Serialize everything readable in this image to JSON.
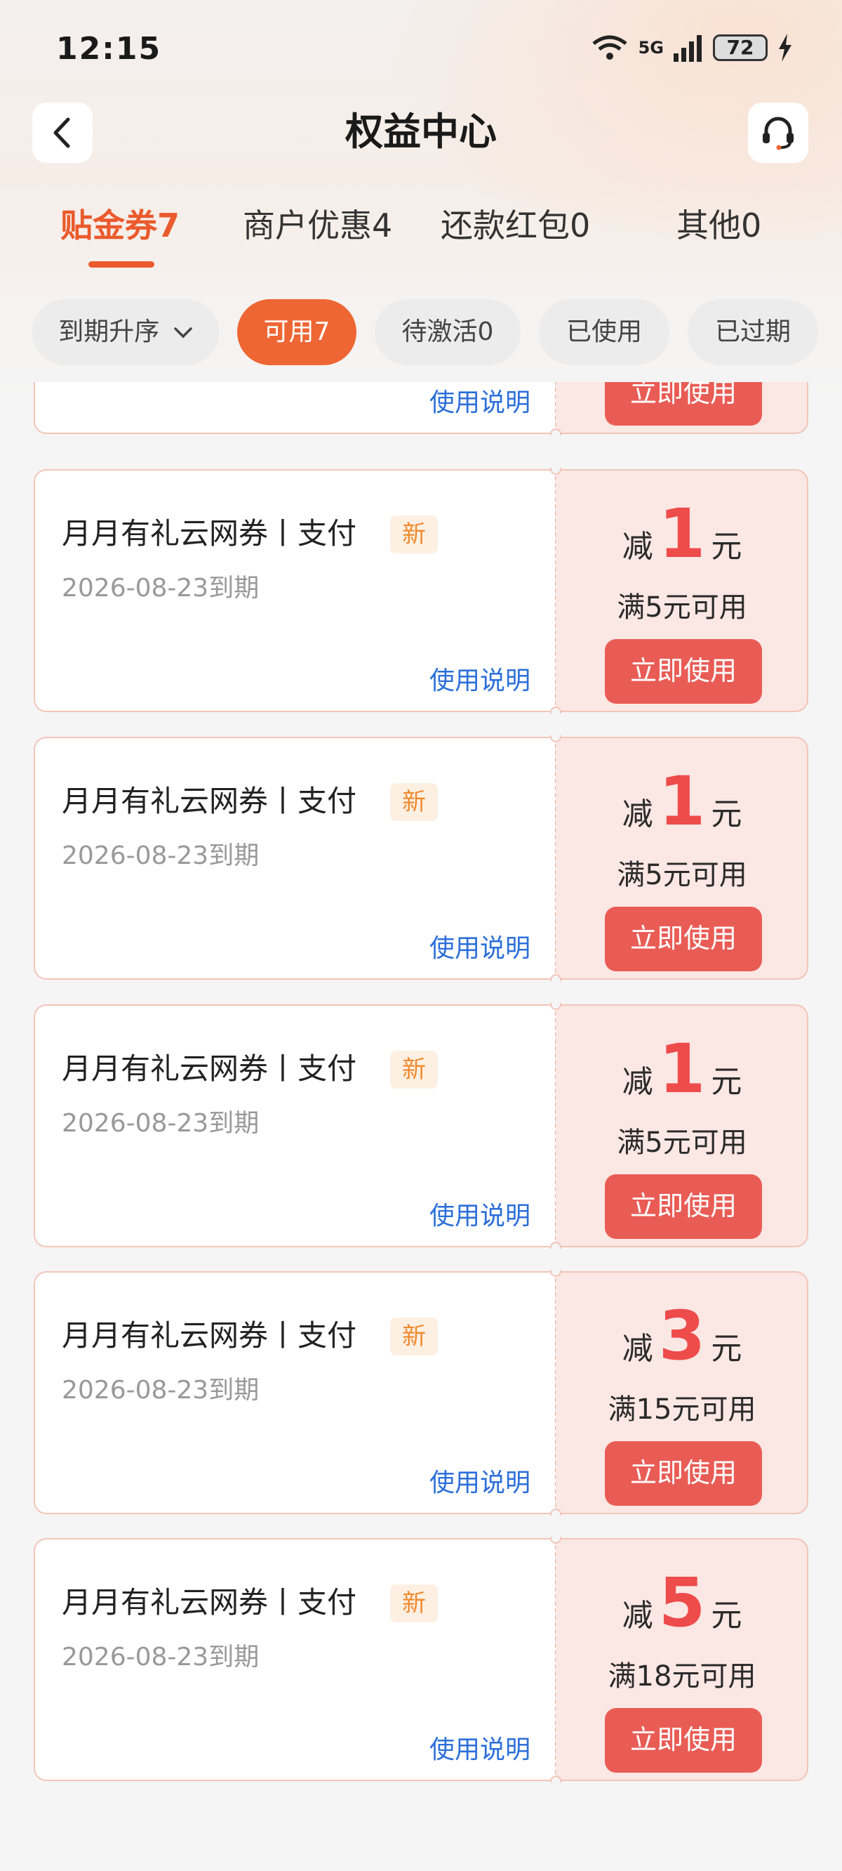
{
  "status_bar": {
    "time": "12:15",
    "battery": "72",
    "network": "5G"
  },
  "header": {
    "title": "权益中心"
  },
  "tabs": [
    {
      "label": "贴金券7",
      "active": true
    },
    {
      "label": "商户优惠4",
      "active": false
    },
    {
      "label": "还款红包0",
      "active": false
    },
    {
      "label": "其他0",
      "active": false
    }
  ],
  "filters": {
    "sort_label": "到期升序",
    "chips": [
      {
        "label": "可用7",
        "active": true
      },
      {
        "label": "待激活0",
        "active": false
      },
      {
        "label": "已使用",
        "active": false
      },
      {
        "label": "已过期",
        "active": false
      }
    ]
  },
  "coupon_labels": {
    "instructions": "使用说明",
    "use_now": "立即使用",
    "badge_new": "新",
    "amount_prefix": "减",
    "amount_unit": "元"
  },
  "coupons": [
    {
      "title": "",
      "date": "",
      "amount": "",
      "min_spend": "",
      "new": false
    },
    {
      "title": "月月有礼云网券丨支付",
      "date": "2026-08-23到期",
      "amount": "1",
      "min_spend": "满5元可用",
      "new": true
    },
    {
      "title": "月月有礼云网券丨支付",
      "date": "2026-08-23到期",
      "amount": "1",
      "min_spend": "满5元可用",
      "new": true
    },
    {
      "title": "月月有礼云网券丨支付",
      "date": "2026-08-23到期",
      "amount": "1",
      "min_spend": "满5元可用",
      "new": true
    },
    {
      "title": "月月有礼云网券丨支付",
      "date": "2026-08-23到期",
      "amount": "3",
      "min_spend": "满15元可用",
      "new": true
    },
    {
      "title": "月月有礼云网券丨支付",
      "date": "2026-08-23到期",
      "amount": "5",
      "min_spend": "满18元可用",
      "new": true
    }
  ],
  "colors": {
    "accent": "#ea5a2c",
    "button": "#e95c55",
    "link": "#2c6fd9",
    "amount": "#ee4b4b"
  }
}
